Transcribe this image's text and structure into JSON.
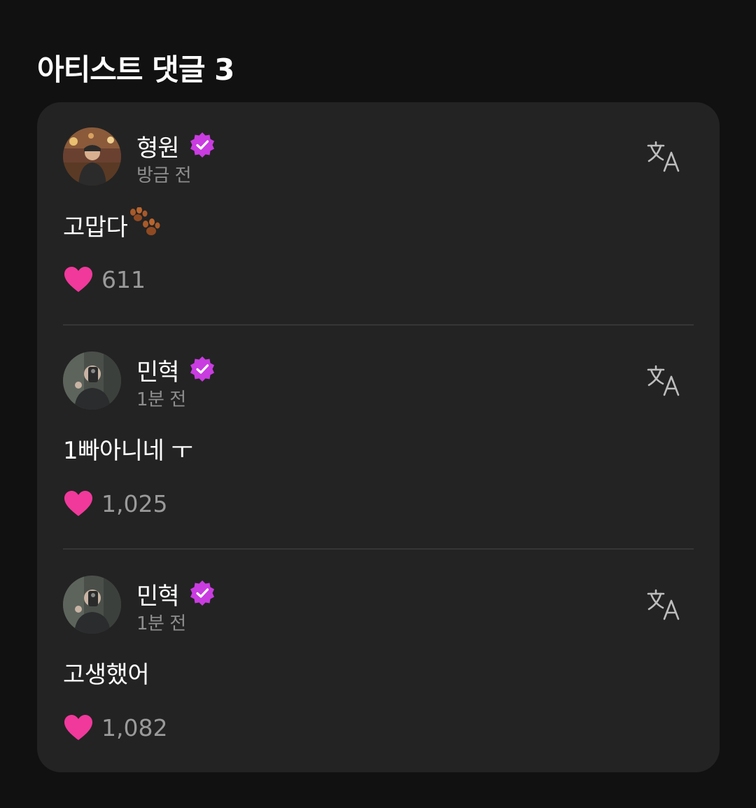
{
  "header": {
    "title": "아티스트 댓글 3"
  },
  "colors": {
    "verified": "#c93ce0",
    "heart": "#f0399b",
    "card": "#232323",
    "background": "#111111"
  },
  "comments": [
    {
      "author": "형원",
      "time": "방금 전",
      "text": "고맙다",
      "emoji": "paw-icon",
      "likes": "611",
      "verified": true
    },
    {
      "author": "민혁",
      "time": "1분 전",
      "text": "1빠아니네 ㅜ",
      "likes": "1,025",
      "verified": true
    },
    {
      "author": "민혁",
      "time": "1분 전",
      "text": "고생했어",
      "likes": "1,082",
      "verified": true
    }
  ]
}
